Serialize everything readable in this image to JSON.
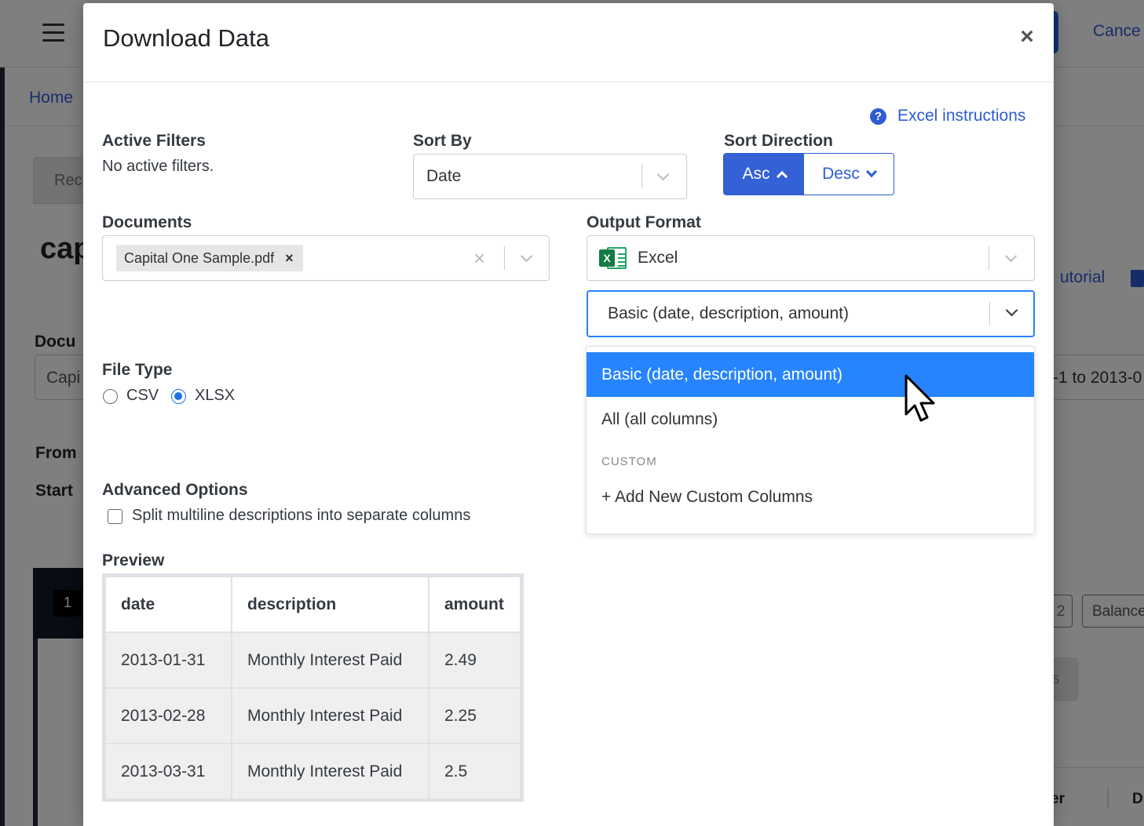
{
  "background": {
    "cancel_label": "Cance",
    "breadcrumb_home": "Home",
    "tab_label": "Rec",
    "heading": "cap",
    "tutorial_link": "utorial",
    "document_label": "Docu",
    "document_value": "Capi",
    "date_range": "-1 to 2013-0",
    "from_label": "From",
    "start_label": "Start",
    "page_number": "1",
    "page_btn": "2",
    "balance_btn": "Balance",
    "gray_btn": "s",
    "footer_col1": "er",
    "footer_col2": "D"
  },
  "modal": {
    "title": "Download Data",
    "close_glyph": "×",
    "excel_instructions": "Excel instructions",
    "help_glyph": "?",
    "active_filters": {
      "label": "Active Filters",
      "value": "No active filters."
    },
    "sort_by": {
      "label": "Sort By",
      "value": "Date"
    },
    "sort_direction": {
      "label": "Sort Direction",
      "asc": "Asc",
      "desc": "Desc",
      "selected": "asc"
    },
    "documents": {
      "label": "Documents",
      "tags": [
        "Capital One Sample.pdf"
      ],
      "tag_remove": "×",
      "clear": "×"
    },
    "output_format": {
      "label": "Output Format",
      "value": "Excel",
      "excel_icon_letter": "X"
    },
    "columns_select": {
      "value": "Basic (date, description, amount)",
      "options": [
        {
          "label": "Basic (date, description, amount)",
          "selected": true
        },
        {
          "label": "All (all columns)",
          "selected": false
        }
      ],
      "group_label": "CUSTOM",
      "add_custom": "+ Add New Custom Columns"
    },
    "file_type": {
      "label": "File Type",
      "options": [
        "CSV",
        "XLSX"
      ],
      "selected": "XLSX"
    },
    "advanced_options": {
      "label": "Advanced Options",
      "split_multiline": "Split multiline descriptions into separate columns",
      "split_checked": false
    },
    "preview": {
      "label": "Preview",
      "columns": [
        "date",
        "description",
        "amount"
      ],
      "rows": [
        [
          "2013-01-31",
          "Monthly Interest Paid",
          "2.49"
        ],
        [
          "2013-02-28",
          "Monthly Interest Paid",
          "2.25"
        ],
        [
          "2013-03-31",
          "Monthly Interest Paid",
          "2.5"
        ]
      ]
    }
  },
  "colors": {
    "primary": "#2f5bd3",
    "option_selected": "#2684ff",
    "excel_green": "#107c41"
  }
}
